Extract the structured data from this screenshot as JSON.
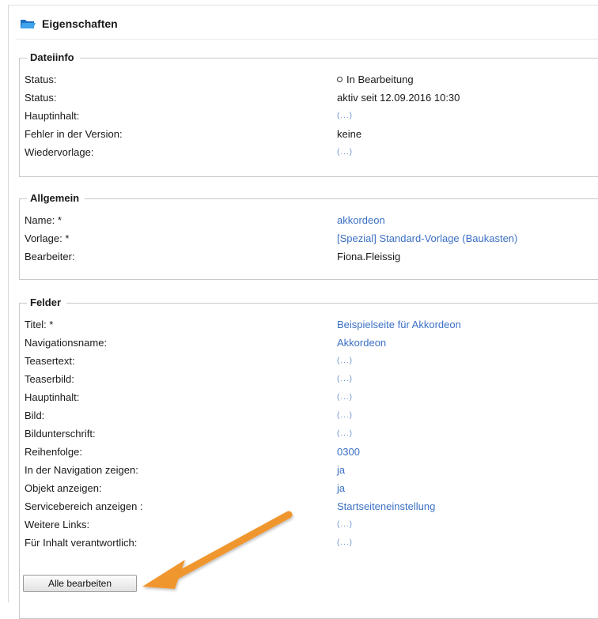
{
  "header": {
    "title": "Eigenschaften",
    "icon": "folder-open-icon"
  },
  "dateiinfo": {
    "legend": "Dateiinfo",
    "rows": [
      {
        "label": "Status:",
        "value": "In Bearbeitung"
      },
      {
        "label": "Status:",
        "value": "aktiv seit 12.09.2016 10:30"
      },
      {
        "label": "Hauptinhalt:",
        "value": "(...)"
      },
      {
        "label": "Fehler in der Version:",
        "value": "keine"
      },
      {
        "label": "Wiedervorlage:",
        "value": "(...)"
      }
    ]
  },
  "allgemein": {
    "legend": "Allgemein",
    "rows": [
      {
        "label": "Name: *",
        "value": "akkordeon"
      },
      {
        "label": "Vorlage: *",
        "value": "[Spezial] Standard-Vorlage (Baukasten)"
      },
      {
        "label": "Bearbeiter:",
        "value": "Fiona.Fleissig"
      }
    ]
  },
  "felder": {
    "legend": "Felder",
    "rows": [
      {
        "label": "Titel: *",
        "value": "Beispielseite für Akkordeon"
      },
      {
        "label": "Navigationsname:",
        "value": "Akkordeon"
      },
      {
        "label": "Teasertext:",
        "value": "(...)"
      },
      {
        "label": "Teaserbild:",
        "value": "(...)"
      },
      {
        "label": "Hauptinhalt:",
        "value": "(...)"
      },
      {
        "label": "Bild:",
        "value": "(...)"
      },
      {
        "label": "Bildunterschrift:",
        "value": "(...)"
      },
      {
        "label": "Reihenfolge:",
        "value": "0300"
      },
      {
        "label": "In der Navigation zeigen:",
        "value": "ja"
      },
      {
        "label": "Objekt anzeigen:",
        "value": "ja"
      },
      {
        "label": "Servicebereich anzeigen :",
        "value": "Startseiteneinstellung"
      },
      {
        "label": "Weitere Links:",
        "value": "(...)"
      },
      {
        "label": "Für Inhalt verantwortlich:",
        "value": "(...)"
      }
    ]
  },
  "actions": {
    "edit_all_label": "Alle bearbeiten"
  },
  "colors": {
    "link": "#3b70c4",
    "folder_icon": "#2f8fe0",
    "arrow": "#f0962e",
    "border": "#c9c9c9"
  }
}
